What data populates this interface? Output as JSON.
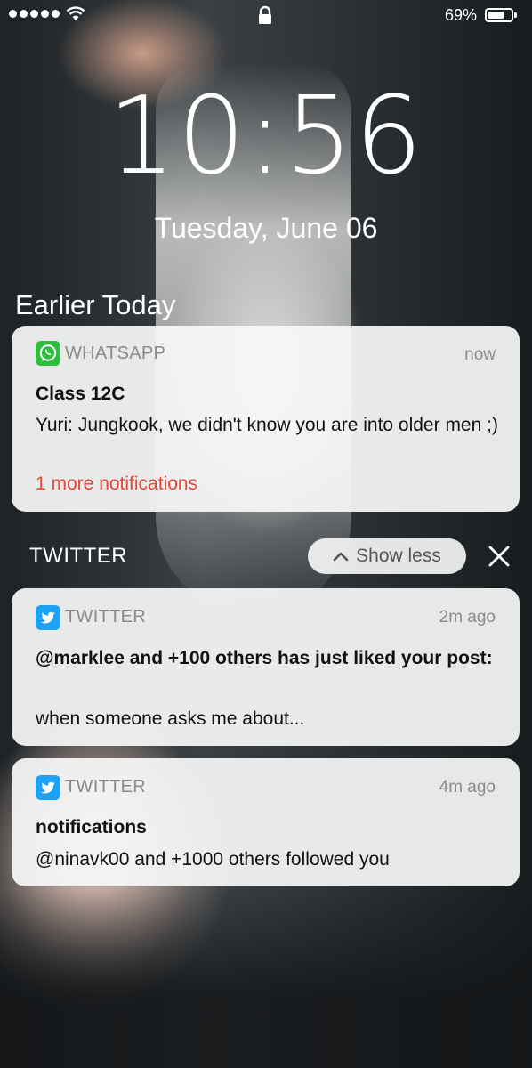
{
  "status_bar": {
    "battery_percent": "69%",
    "battery_level": 0.69,
    "signal_icon": "signal-dots-icon",
    "wifi_icon": "wifi-icon",
    "lock_icon": "lock-icon"
  },
  "lock_screen": {
    "time": "10:56",
    "date": "Tuesday, June 06"
  },
  "section": {
    "title": "Earlier Today"
  },
  "notifications": [
    {
      "app": "WHATSAPP",
      "time": "now",
      "title": "Class 12C",
      "body": "Yuri: Jungkook, we didn't know you are into older men ;)",
      "more": "1 more notifications",
      "icon": "whatsapp-icon",
      "icon_color": "#2fbd3f"
    }
  ],
  "twitter_group": {
    "label": "TWITTER",
    "show_less_label": "Show less",
    "items": [
      {
        "app": "TWITTER",
        "time": "2m ago",
        "title": "@marklee and +100 others has just liked your post:",
        "body": "when someone asks me about...",
        "icon": "twitter-bird-icon",
        "icon_color": "#1da1f2"
      },
      {
        "app": "TWITTER",
        "time": "4m ago",
        "title": "notifications",
        "body": "@ninavk00 and +1000 others followed you",
        "icon": "twitter-bird-icon",
        "icon_color": "#1da1f2"
      }
    ]
  },
  "colors": {
    "accent_red": "#e0483a",
    "card_bg": "#f8f8f8"
  }
}
